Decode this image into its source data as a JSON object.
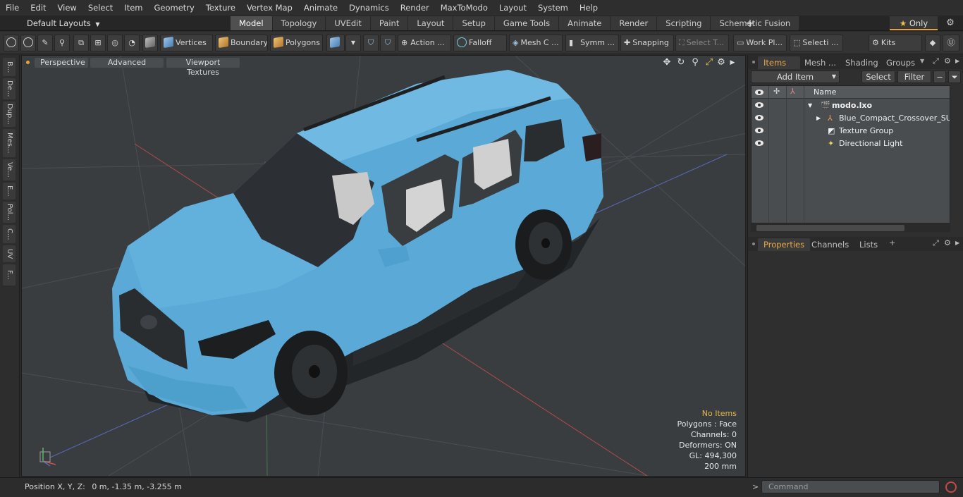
{
  "menu": [
    "File",
    "Edit",
    "View",
    "Select",
    "Item",
    "Geometry",
    "Texture",
    "Vertex Map",
    "Animate",
    "Dynamics",
    "Render",
    "MaxToModo",
    "Layout",
    "System",
    "Help"
  ],
  "layout_selector": "Default Layouts",
  "layout_tabs": [
    "Model",
    "Topology",
    "UVEdit",
    "Paint",
    "Layout",
    "Setup",
    "Game Tools",
    "Animate",
    "Render",
    "Scripting",
    "Schematic Fusion"
  ],
  "active_layout_tab": "Model",
  "only_label": "Only",
  "toolbar": {
    "vertices": "Vertices",
    "boundary": "Boundary",
    "polygons": "Polygons",
    "action": "Action ...",
    "falloff": "Falloff",
    "mesh": "Mesh C ...",
    "symm": "Symm ...",
    "snapping": "Snapping",
    "select_t": "Select T...",
    "work_pl": "Work Pl...",
    "selecti": "Selecti ...",
    "kits": "Kits"
  },
  "left_tabs": [
    "B...",
    "De...",
    "Dup...",
    "Mes...",
    "Ve...",
    "E...",
    "Pol...",
    "C...",
    "UV",
    "F..."
  ],
  "viewport": {
    "perspective": "Perspective",
    "advanced": "Advanced",
    "textures": "Viewport Textures",
    "info": {
      "no_items": "No Items",
      "polygons": "Polygons : Face",
      "channels": "Channels: 0",
      "deformers": "Deformers: ON",
      "gl": "GL: 494,300",
      "scale": "200 mm"
    }
  },
  "status": {
    "position_label": "Position X, Y, Z:",
    "position_value": "0 m, -1.35 m, -3.255 m"
  },
  "items_panel": {
    "tabs": [
      "Items",
      "Mesh ...",
      "Shading",
      "Groups"
    ],
    "add_item": "Add Item",
    "select": "Select",
    "filter": "Filter",
    "name_col": "Name",
    "tree": [
      {
        "label": "modo.lxo"
      },
      {
        "label": "Blue_Compact_Crossover_SUV"
      },
      {
        "label": "Texture Group"
      },
      {
        "label": "Directional Light"
      }
    ]
  },
  "props_panel": {
    "tabs": [
      "Properties",
      "Channels",
      "Lists"
    ]
  },
  "command": {
    "placeholder": "Command"
  },
  "colors": {
    "accent": "#e9a94a",
    "car_body": "#5aa9d6",
    "viewport_bg": "#3a3d40"
  }
}
